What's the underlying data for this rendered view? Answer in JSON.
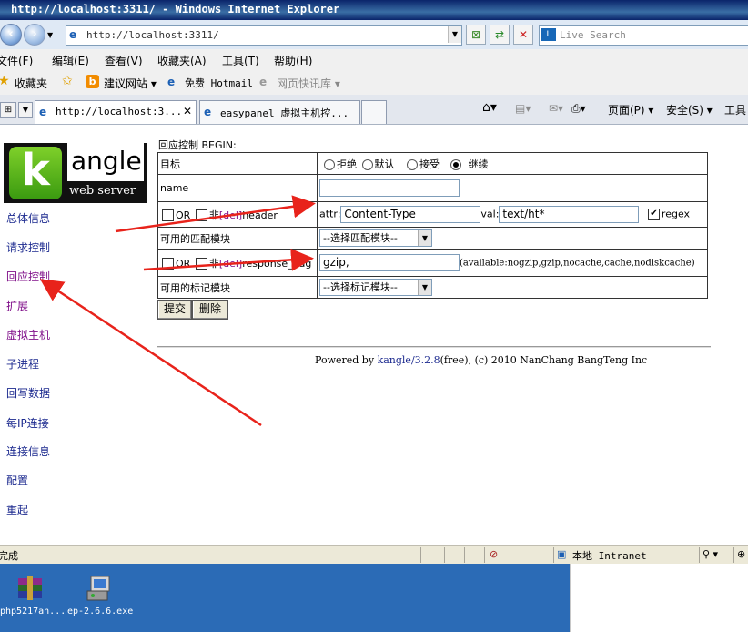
{
  "window": {
    "title": "http://localhost:3311/ - Windows Internet Explorer"
  },
  "address_bar": {
    "url": "http://localhost:3311/",
    "search_placeholder": "Live Search"
  },
  "menu": [
    "文件(F)",
    "编辑(E)",
    "查看(V)",
    "收藏夹(A)",
    "工具(T)",
    "帮助(H)"
  ],
  "favorites": {
    "label": "收藏夹",
    "items": [
      "建议网站 ▾",
      "免费 Hotmail",
      "网页快讯库 ▾"
    ]
  },
  "tabs": [
    {
      "label": "http://localhost:3..."
    },
    {
      "label": "easypanel 虚拟主机控..."
    }
  ],
  "commandbar": {
    "page": "页面(P) ▾",
    "safety": "安全(S) ▾",
    "tools": "工具"
  },
  "logo": {
    "brand": "angle",
    "k": "k",
    "tagline": "web server"
  },
  "sidebar": {
    "items": [
      "总体信息",
      "请求控制",
      "回应控制",
      "扩展",
      "虚拟主机",
      "子进程",
      "回写数据",
      "每IP连接",
      "连接信息",
      "配置",
      "重起"
    ]
  },
  "form": {
    "title": "回应控制 BEGIN:",
    "target_label": "目标",
    "target_options": [
      "拒绝",
      "默认",
      "接受",
      "继续"
    ],
    "target_selected": "继续",
    "name_label": "name",
    "name_value": "",
    "rule1": {
      "or": "OR",
      "not": "非",
      "bracket": "[del]",
      "type": "header",
      "attr_label": "attr:",
      "attr_value": "Content-Type",
      "val_label": "val:",
      "val_value": "text/ht*",
      "regex_label": "regex",
      "regex_checked": true
    },
    "match_module_label": "可用的匹配模块",
    "match_module_select": "--选择匹配模块--",
    "rule2": {
      "or": "OR",
      "not": "非",
      "bracket": "[del]",
      "type": "response_flag",
      "value": "gzip,",
      "available": "(available:nogzip,gzip,nocache,cache,nodiskcache)"
    },
    "mark_module_label": "可用的标记模块",
    "mark_module_select": "--选择标记模块--",
    "submit": "提交",
    "delete": "删除"
  },
  "footer": {
    "prefix": "Powered by ",
    "link": "kangle/3.2.8",
    "suffix": "(free), (c) 2010 NanChang BangTeng Inc"
  },
  "statusbar": {
    "left": "完成",
    "zone": "本地 Intranet"
  },
  "desktop": {
    "icons": [
      "php5217an...",
      "ep-2.6.6.exe"
    ]
  },
  "colors": {
    "titlebar": "#0a246a",
    "link": "#1c2a8f",
    "visited": "#80108a",
    "arrow": "#e8231b",
    "desktop": "#2b6bb6"
  }
}
